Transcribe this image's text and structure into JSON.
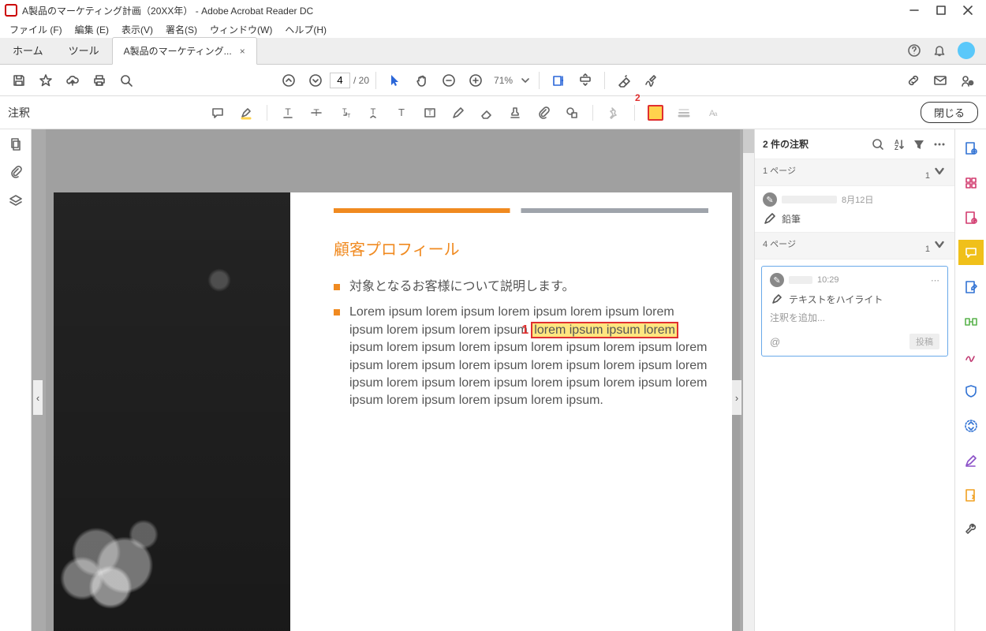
{
  "window": {
    "title": "A製品のマーケティング計画（20XX年） - Adobe Acrobat Reader DC"
  },
  "menubar": {
    "file": "ファイル (F)",
    "edit": "編集 (E)",
    "view": "表示(V)",
    "sign": "署名(S)",
    "window": "ウィンドウ(W)",
    "help": "ヘルプ(H)"
  },
  "tabs": {
    "home": "ホーム",
    "tool": "ツール",
    "doc": "A製品のマーケティング..."
  },
  "toolbar": {
    "page_current": "4",
    "page_total": "/ 20",
    "zoom": "71%"
  },
  "anno_bar": {
    "label": "注釈",
    "close": "閉じる",
    "badge": "2"
  },
  "document": {
    "heading": "顧客プロフィール",
    "bullet1": "対象となるお客様について説明します。",
    "bullet2a": "Lorem ipsum lorem ipsum lorem ipsum lorem ipsum lorem ipsum lorem ipsum lorem ipsum ",
    "highlight": "lorem ipsum ipsum lorem",
    "highlight_num": "1",
    "bullet2b": " ipsum lorem ipsum lorem ipsum lorem ipsum lorem ipsum lorem ipsum lorem ipsum lorem ipsum lorem ipsum lorem ipsum lorem ipsum lorem ipsum lorem ipsum lorem ipsum lorem ipsum lorem ipsum lorem ipsum lorem ipsum lorem ipsum."
  },
  "comments": {
    "header": "2 件の注釈",
    "page1_label": "1 ページ",
    "page1_count": "1",
    "c1_time": "8月12日",
    "c1_type": "鉛筆",
    "page4_label": "4 ページ",
    "page4_count": "1",
    "c2_time": "10:29",
    "c2_type": "テキストをハイライト",
    "add_placeholder": "注釈を追加...",
    "mention": "@",
    "post": "投稿"
  },
  "nav": {}
}
